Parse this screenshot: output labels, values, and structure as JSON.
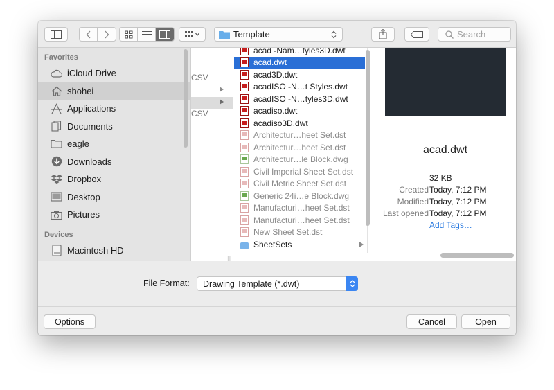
{
  "toolbar": {
    "path_folder": "Template",
    "search_placeholder": "Search"
  },
  "sidebar": {
    "favorites_header": "Favorites",
    "favorites": [
      {
        "label": "iCloud Drive",
        "icon": "cloud-icon"
      },
      {
        "label": "shohei",
        "icon": "home-icon",
        "selected": true
      },
      {
        "label": "Applications",
        "icon": "applications-icon"
      },
      {
        "label": "Documents",
        "icon": "documents-icon"
      },
      {
        "label": "eagle",
        "icon": "folder-icon"
      },
      {
        "label": "Downloads",
        "icon": "downloads-icon"
      },
      {
        "label": "Dropbox",
        "icon": "dropbox-icon"
      },
      {
        "label": "Desktop",
        "icon": "desktop-icon"
      },
      {
        "label": "Pictures",
        "icon": "camera-icon"
      }
    ],
    "devices_header": "Devices",
    "devices": [
      {
        "label": "Macintosh HD",
        "icon": "hard-drive-icon"
      }
    ]
  },
  "parent_column": {
    "items": [
      "CSV",
      "CSV"
    ]
  },
  "files": [
    {
      "name": "acad -Nam…tyles3D.dwt",
      "type": "dwt"
    },
    {
      "name": "acad.dwt",
      "type": "dwt",
      "selected": true
    },
    {
      "name": "acad3D.dwt",
      "type": "dwt"
    },
    {
      "name": "acadISO -N…t Styles.dwt",
      "type": "dwt"
    },
    {
      "name": "acadISO -N…tyles3D.dwt",
      "type": "dwt"
    },
    {
      "name": "acadiso.dwt",
      "type": "dwt"
    },
    {
      "name": "acadiso3D.dwt",
      "type": "dwt"
    },
    {
      "name": "Architectur…heet Set.dst",
      "type": "dst",
      "dimmed": true
    },
    {
      "name": "Architectur…heet Set.dst",
      "type": "dst",
      "dimmed": true
    },
    {
      "name": "Architectur…le Block.dwg",
      "type": "dwg",
      "dimmed": true
    },
    {
      "name": "Civil Imperial Sheet Set.dst",
      "type": "dst",
      "dimmed": true
    },
    {
      "name": "Civil Metric Sheet Set.dst",
      "type": "dst",
      "dimmed": true
    },
    {
      "name": "Generic 24i…e Block.dwg",
      "type": "dwg",
      "dimmed": true
    },
    {
      "name": "Manufacturi…heet Set.dst",
      "type": "dst",
      "dimmed": true
    },
    {
      "name": "Manufacturi…heet Set.dst",
      "type": "dst",
      "dimmed": true
    },
    {
      "name": "New Sheet Set.dst",
      "type": "dst",
      "dimmed": true
    },
    {
      "name": "SheetSets",
      "type": "folder"
    }
  ],
  "preview": {
    "file_name": "acad.dwt",
    "size": "32 KB",
    "created_label": "Created",
    "created_value": "Today, 7:12 PM",
    "modified_label": "Modified",
    "modified_value": "Today, 7:12 PM",
    "last_opened_label": "Last opened",
    "last_opened_value": "Today, 7:12 PM",
    "add_tags": "Add Tags…"
  },
  "file_format": {
    "label": "File Format:",
    "value": "Drawing Template (*.dwt)"
  },
  "buttons": {
    "options": "Options",
    "cancel": "Cancel",
    "open": "Open"
  },
  "colors": {
    "selection": "#2a6fd6",
    "accent": "#3b86f2",
    "link": "#2d7ce0"
  }
}
